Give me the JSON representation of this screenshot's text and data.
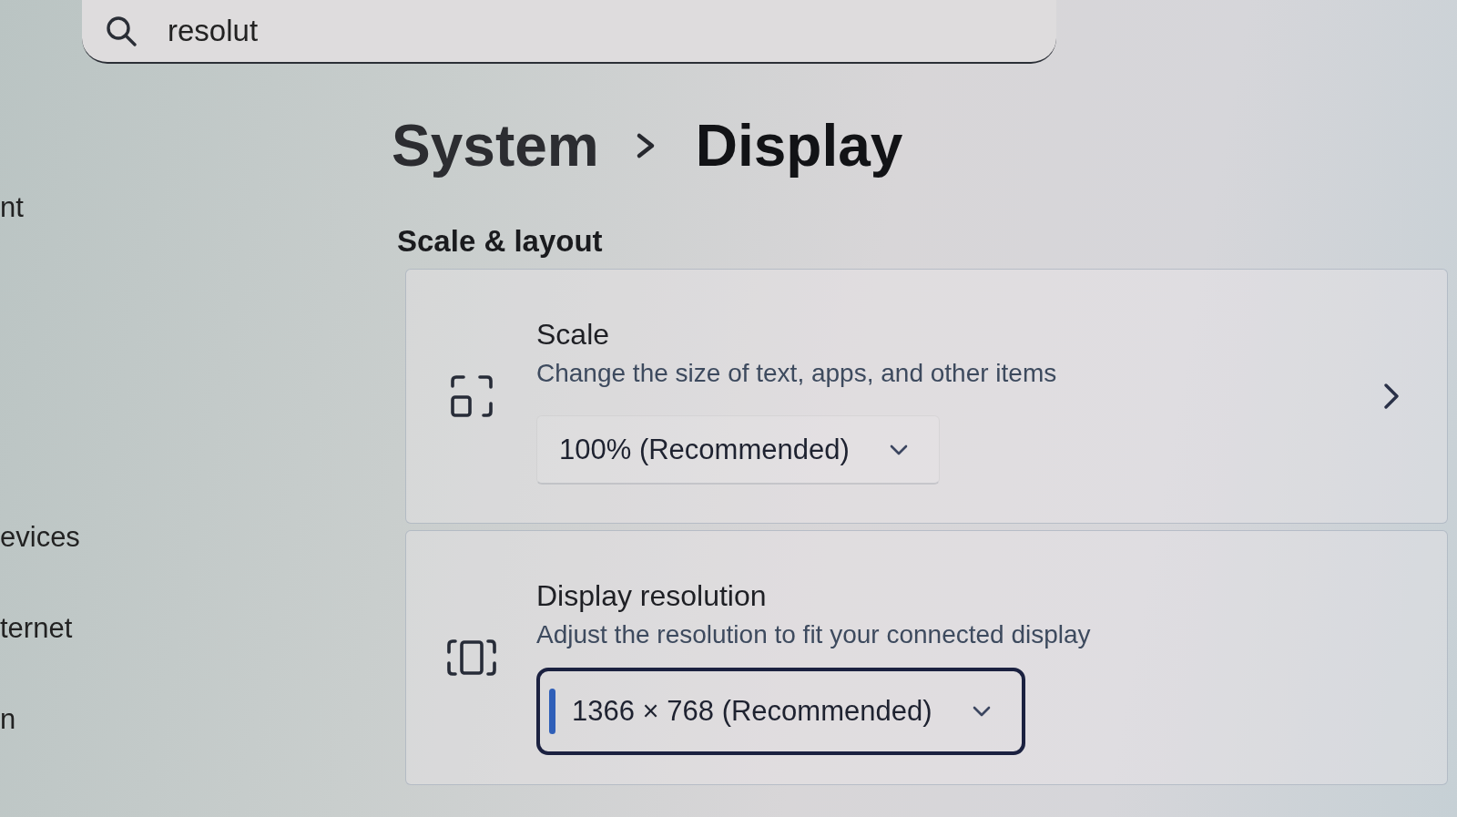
{
  "search": {
    "value": "resolut"
  },
  "sidebar": {
    "items": [
      {
        "label": "nt"
      },
      {
        "label": "evices"
      },
      {
        "label": "ternet"
      },
      {
        "label": "n"
      }
    ]
  },
  "breadcrumb": [
    {
      "label": "System"
    },
    {
      "label": "Display"
    }
  ],
  "section": {
    "title": "Scale & layout"
  },
  "settings": [
    {
      "kind": "scale",
      "title": "Scale",
      "description": "Change the size of text, apps, and other items",
      "dropdown": {
        "value": "100% (Recommended)",
        "focused": false
      },
      "link": true
    },
    {
      "kind": "resolution",
      "title": "Display resolution",
      "description": "Adjust the resolution to fit your connected display",
      "dropdown": {
        "value": "1366 × 768 (Recommended)",
        "focused": true
      },
      "link": false
    }
  ]
}
